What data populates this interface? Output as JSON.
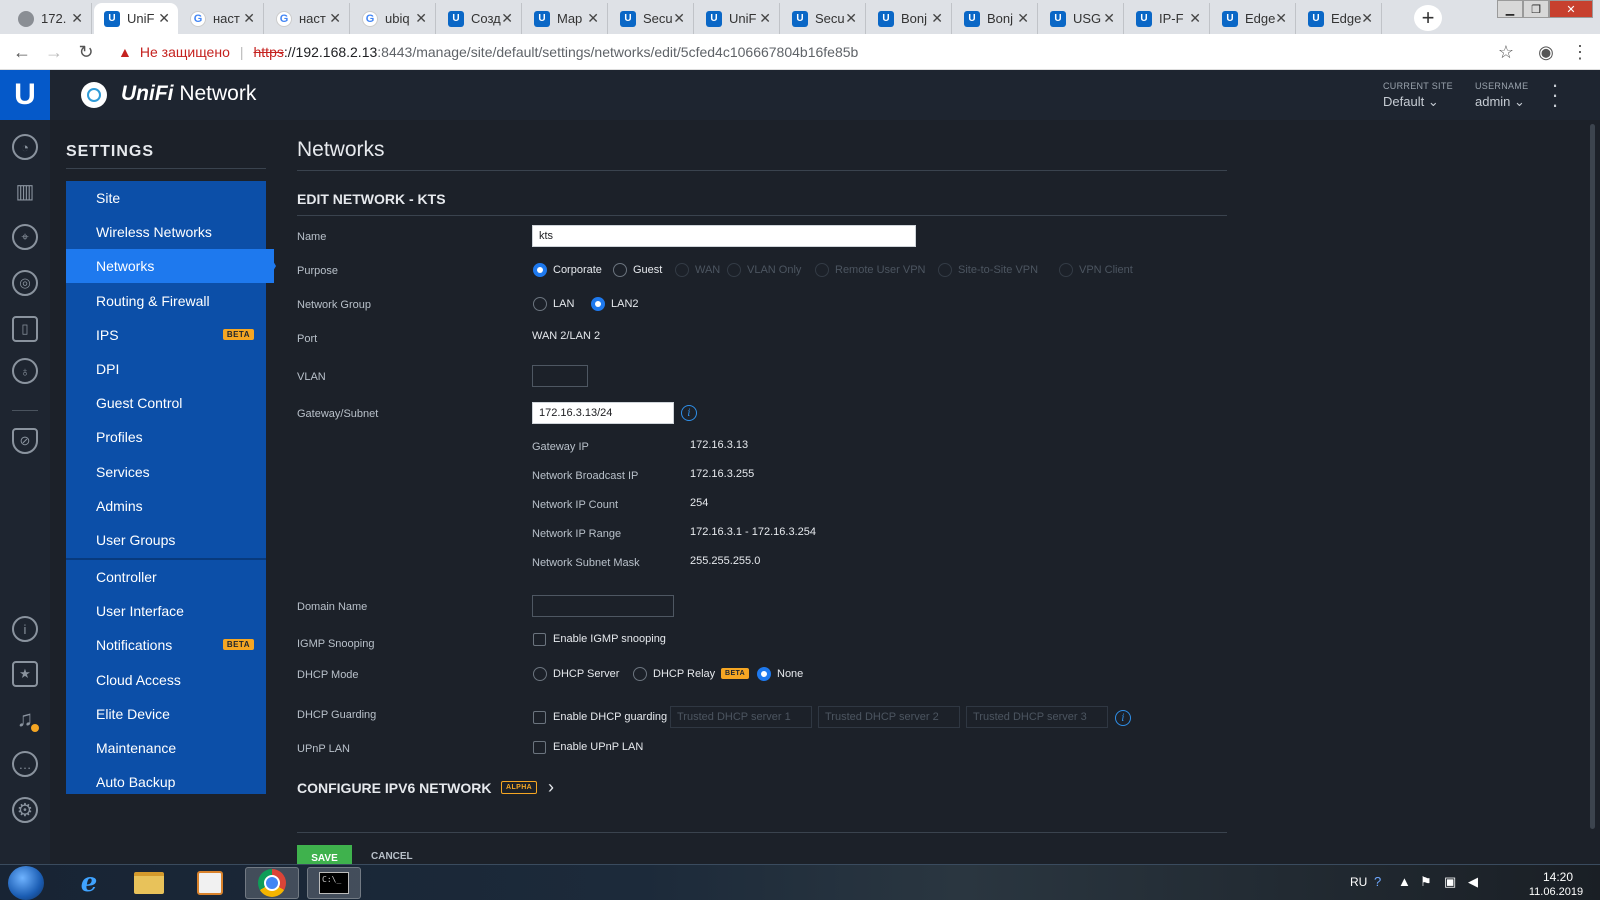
{
  "browser": {
    "tabs": [
      {
        "title": "172.",
        "icon": "globe-icon"
      },
      {
        "title": "UniF",
        "icon": "unifi-icon",
        "active": true
      },
      {
        "title": "наст",
        "icon": "google-icon"
      },
      {
        "title": "наст",
        "icon": "google-icon"
      },
      {
        "title": "ubiq",
        "icon": "google-icon"
      },
      {
        "title": "Созд",
        "icon": "unifi-icon"
      },
      {
        "title": "Map",
        "icon": "unifi-icon"
      },
      {
        "title": "Secu",
        "icon": "unifi-icon"
      },
      {
        "title": "UniF",
        "icon": "unifi-icon"
      },
      {
        "title": "Secu",
        "icon": "unifi-icon"
      },
      {
        "title": "Bonj",
        "icon": "unifi-icon"
      },
      {
        "title": "Bonj",
        "icon": "unifi-icon"
      },
      {
        "title": "USG",
        "icon": "unifi-icon"
      },
      {
        "title": "IP-F",
        "icon": "unifi-icon"
      },
      {
        "title": "Edge",
        "icon": "unifi-icon"
      },
      {
        "title": "Edge",
        "icon": "unifi-icon"
      }
    ],
    "security_text": "Не защищено",
    "url_scheme": "https",
    "url_host": "://192.168.2.13",
    "url_rest": ":8443/manage/site/default/settings/networks/edit/5cfed4c106667804b16fe85b"
  },
  "header": {
    "brand_italic": "UniFi",
    "brand_rest": " Network",
    "site_label": "CURRENT SITE",
    "site_value": "Default",
    "user_label": "USERNAME",
    "user_value": "admin"
  },
  "settings": {
    "title": "SETTINGS",
    "menu_primary": [
      {
        "label": "Site"
      },
      {
        "label": "Wireless Networks"
      },
      {
        "label": "Networks",
        "active": true
      },
      {
        "label": "Routing & Firewall"
      },
      {
        "label": "IPS",
        "badge": "BETA"
      },
      {
        "label": "DPI"
      },
      {
        "label": "Guest Control"
      },
      {
        "label": "Profiles"
      },
      {
        "label": "Services"
      },
      {
        "label": "Admins"
      },
      {
        "label": "User Groups"
      }
    ],
    "menu_secondary": [
      {
        "label": "Controller"
      },
      {
        "label": "User Interface"
      },
      {
        "label": "Notifications",
        "badge": "BETA"
      },
      {
        "label": "Cloud Access"
      },
      {
        "label": "Elite Device"
      },
      {
        "label": "Maintenance"
      },
      {
        "label": "Auto Backup"
      }
    ]
  },
  "form": {
    "page_title": "Networks",
    "edit_title": "EDIT NETWORK - KTS",
    "name_label": "Name",
    "name_value": "kts",
    "purpose_label": "Purpose",
    "purpose_options": [
      "Corporate",
      "Guest",
      "WAN",
      "VLAN Only",
      "Remote User VPN",
      "Site-to-Site VPN",
      "VPN Client"
    ],
    "purpose_selected": "Corporate",
    "group_label": "Network Group",
    "group_options": [
      "LAN",
      "LAN2"
    ],
    "group_selected": "LAN2",
    "port_label": "Port",
    "port_value": "WAN 2/LAN 2",
    "vlan_label": "VLAN",
    "vlan_value": "",
    "gateway_label": "Gateway/Subnet",
    "gateway_value": "172.16.3.13/24",
    "details": [
      {
        "label": "Gateway IP",
        "value": "172.16.3.13"
      },
      {
        "label": "Network Broadcast IP",
        "value": "172.16.3.255"
      },
      {
        "label": "Network IP Count",
        "value": "254"
      },
      {
        "label": "Network IP Range",
        "value": "172.16.3.1 - 172.16.3.254"
      },
      {
        "label": "Network Subnet Mask",
        "value": "255.255.255.0"
      }
    ],
    "domain_label": "Domain Name",
    "domain_value": "",
    "igmp_label": "IGMP Snooping",
    "igmp_check": "Enable IGMP snooping",
    "dhcp_mode_label": "DHCP Mode",
    "dhcp_server": "DHCP Server",
    "dhcp_relay": "DHCP Relay",
    "dhcp_relay_badge": "BETA",
    "dhcp_none": "None",
    "dhcp_mode_selected": "None",
    "guard_label": "DHCP Guarding",
    "guard_check": "Enable DHCP guarding",
    "guard_ph1": "Trusted DHCP server 1",
    "guard_ph2": "Trusted DHCP server 2",
    "guard_ph3": "Trusted DHCP server 3",
    "upnp_label": "UPnP LAN",
    "upnp_check": "Enable UPnP LAN",
    "ipv6_title": "CONFIGURE IPV6 NETWORK",
    "ipv6_badge": "ALPHA",
    "save_label": "SAVE",
    "cancel_label": "CANCEL"
  },
  "taskbar": {
    "lang": "RU",
    "time": "14:20",
    "date": "11.06.2019"
  },
  "colors": {
    "accent": "#1e79ee",
    "menu_bg": "#0c4fa8",
    "beta": "#f5a623",
    "save": "#3fb24d"
  }
}
